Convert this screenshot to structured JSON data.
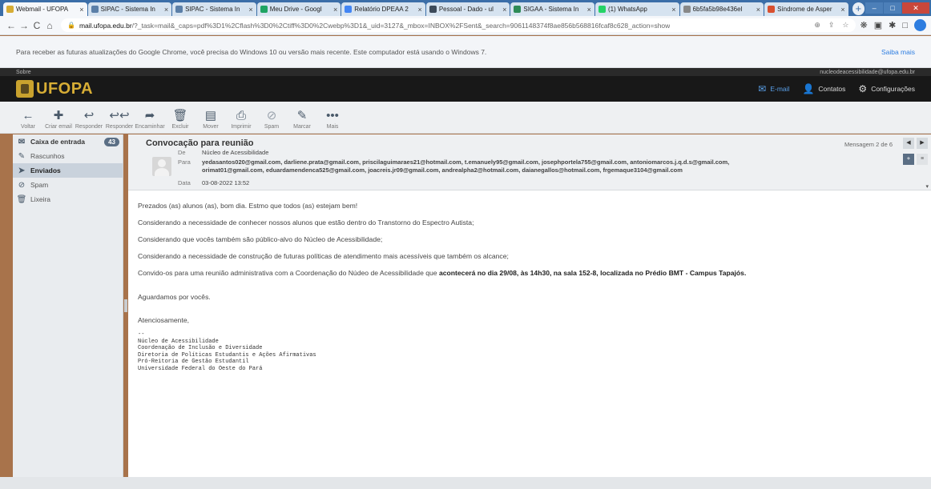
{
  "browser": {
    "tabs": [
      {
        "title": "Webmail - UFOPA",
        "color": "#d7ad35",
        "active": true
      },
      {
        "title": "SIPAC - Sistema In",
        "color": "#5b7fa8",
        "active": false
      },
      {
        "title": "SIPAC - Sistema In",
        "color": "#5b7fa8",
        "active": false
      },
      {
        "title": "Meu Drive - Googl",
        "color": "#1fa463",
        "active": false
      },
      {
        "title": "Relatório DPEAA 2",
        "color": "#4285f4",
        "active": false
      },
      {
        "title": "Pessoal - Dado - ul",
        "color": "#3c4a5a",
        "active": false
      },
      {
        "title": "SIGAA - Sistema In",
        "color": "#2e8b57",
        "active": false
      },
      {
        "title": "(1) WhatsApp",
        "color": "#25d366",
        "active": false
      },
      {
        "title": "6b5fa5b98e436el",
        "color": "#888888",
        "active": false
      },
      {
        "title": "Síndrome de Asper",
        "color": "#d9502f",
        "active": false
      }
    ],
    "new_tab": "+",
    "url_host": "mail.ufopa.edu.br",
    "url_rest": "/?_task=mail&_caps=pdf%3D1%2Cflash%3D0%2Ctiff%3D0%2Cwebp%3D1&_uid=3127&_mbox=INBOX%2FSent&_search=9061148374f8ae856b568816fcaf8c628_action=show",
    "infobar_text": "Para receber as futuras atualizações do Google Chrome, você precisa do Windows 10 ou versão mais recente. Este computador está usando o Windows 7.",
    "infobar_more": "Saiba mais"
  },
  "webmail": {
    "top_label": "Sobre",
    "user_email": "nucleodeacessibilidade@ufopa.edu.br",
    "logo_text": "UFOPA",
    "nav": [
      {
        "label": "E-mail",
        "icon": "✉"
      },
      {
        "label": "Contatos",
        "icon": "👤"
      },
      {
        "label": "Configurações",
        "icon": "⚙"
      }
    ],
    "toolbar": [
      {
        "label": "Voltar",
        "icon": "←"
      },
      {
        "label": "Criar email",
        "icon": "✚"
      },
      {
        "label": "Responder",
        "icon": "↩"
      },
      {
        "label": "Responder",
        "icon": "↩↩"
      },
      {
        "label": "Encaminhar",
        "icon": "➦"
      },
      {
        "label": "Excluir",
        "icon": "🗑"
      },
      {
        "label": "Mover",
        "icon": "▤"
      },
      {
        "label": "Imprimir",
        "icon": "⎙"
      },
      {
        "label": "Spam",
        "icon": "⊘"
      },
      {
        "label": "Marcar",
        "icon": "✎"
      },
      {
        "label": "Mais",
        "icon": "•••"
      }
    ],
    "folders": [
      {
        "label": "Caixa de entrada",
        "icon": "✉",
        "badge": "43",
        "bold": true,
        "selected": false
      },
      {
        "label": "Rascunhos",
        "icon": "✎",
        "badge": "",
        "bold": false,
        "selected": false
      },
      {
        "label": "Enviados",
        "icon": "➤",
        "badge": "",
        "bold": false,
        "selected": true
      },
      {
        "label": "Spam",
        "icon": "⊘",
        "badge": "",
        "bold": false,
        "selected": false
      },
      {
        "label": "Lixeira",
        "icon": "🗑",
        "badge": "",
        "bold": false,
        "selected": false
      }
    ]
  },
  "message": {
    "subject": "Convocação para reunião",
    "count": "Mensagem 2 de 6",
    "from_label": "De",
    "from": "Núcleo de Acessibilidade",
    "to_label": "Para",
    "to_line1": "yedasantos020@gmail.com, darliene.prata@gmail.com, priscilaguimaraes21@hotmail.com, t.emanuely95@gmail.com, josephportela755@gmail.com, antoniomarcos.j.q.d.s@gmail.com,",
    "to_line2": "orimat01@gmail.com, eduardamendenca525@gmail.com, joacreis.jr09@gmail.com, andrealpha2@hotmail.com, daianegallos@hotmail.com, frgemaque3104@gmail.com",
    "date_label": "Data",
    "date": "03-08-2022 13:52",
    "body": {
      "p1": "Prezados (as) alunos (as), bom dia. Estmo que todos (as) estejam bem!",
      "p2": "Considerando a necessidade de conhecer nossos alunos que estão dentro do Transtorno do Espectro Autista;",
      "p3": "Considerando que vocês também são público-alvo do Núcleo de Acessibilidade;",
      "p4": "Considerando a necessidade de construção de futuras políticas de atendimento mais acessíveis que também os alcance;",
      "p5_start": "Convido-os para uma reunião administrativa com a Coordenação do Núdeo de Acessibilidade que ",
      "p5_bold": "acontecerá no dia 29/08, às 14h30, na sala 152-8, localizada no Prédio BMT - Campus Tapajós.",
      "p6": "Aguardamos por vocês.",
      "p7": "Atenciosamente,",
      "sig": "--\nNúcleo de Acessibilidade\nCoordenação de Inclusão e Diversidade\nDiretoria de Políticas Estudantis e Ações Afirmativas\nPró-Reitoria de Gestão Estudantil\nUniversidade Federal do Oeste do Pará"
    }
  }
}
